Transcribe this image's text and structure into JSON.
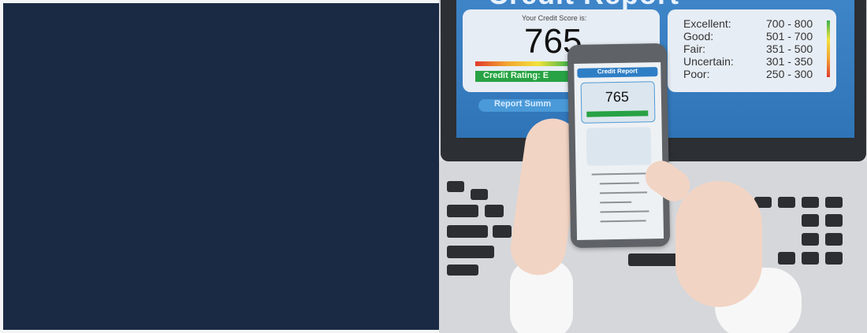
{
  "banner": {
    "photo": {
      "laptop_screen": {
        "title": "Credit Report",
        "score_caption": "Your Credit Score is:",
        "score": "765",
        "rating_label": "Credit Rating: E",
        "summary_label": "Report Summ",
        "ranges": [
          {
            "label": "Excellent:",
            "range": "700 - 800"
          },
          {
            "label": "Good:",
            "range": "501 - 700"
          },
          {
            "label": "Fair:",
            "range": "351 - 500"
          },
          {
            "label": "Uncertain:",
            "range": "301 - 350"
          },
          {
            "label": "Poor:",
            "range": "250 - 300"
          }
        ]
      },
      "phone_screen": {
        "title": "Credit Report",
        "score": "765"
      }
    }
  }
}
